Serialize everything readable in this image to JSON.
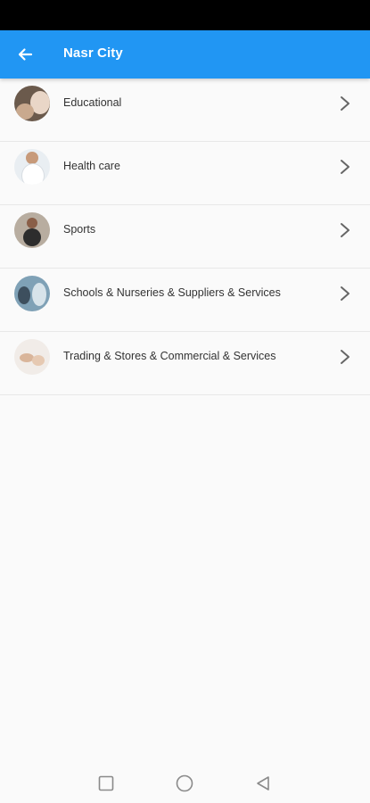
{
  "header": {
    "title": "Nasr City",
    "back_icon": "arrow-left-icon",
    "background_color": "#2196f3"
  },
  "categories": [
    {
      "label": "Educational",
      "icon": "educational-avatar"
    },
    {
      "label": "Health care",
      "icon": "health-care-avatar"
    },
    {
      "label": "Sports",
      "icon": "sports-avatar"
    },
    {
      "label": "Schools & Nurseries  & Suppliers & Services",
      "icon": "schools-avatar"
    },
    {
      "label": "Trading & Stores & Commercial & Services",
      "icon": "trading-avatar"
    }
  ],
  "navigation": {
    "recent_icon": "square-icon",
    "home_icon": "circle-icon",
    "back_icon": "triangle-back-icon"
  }
}
